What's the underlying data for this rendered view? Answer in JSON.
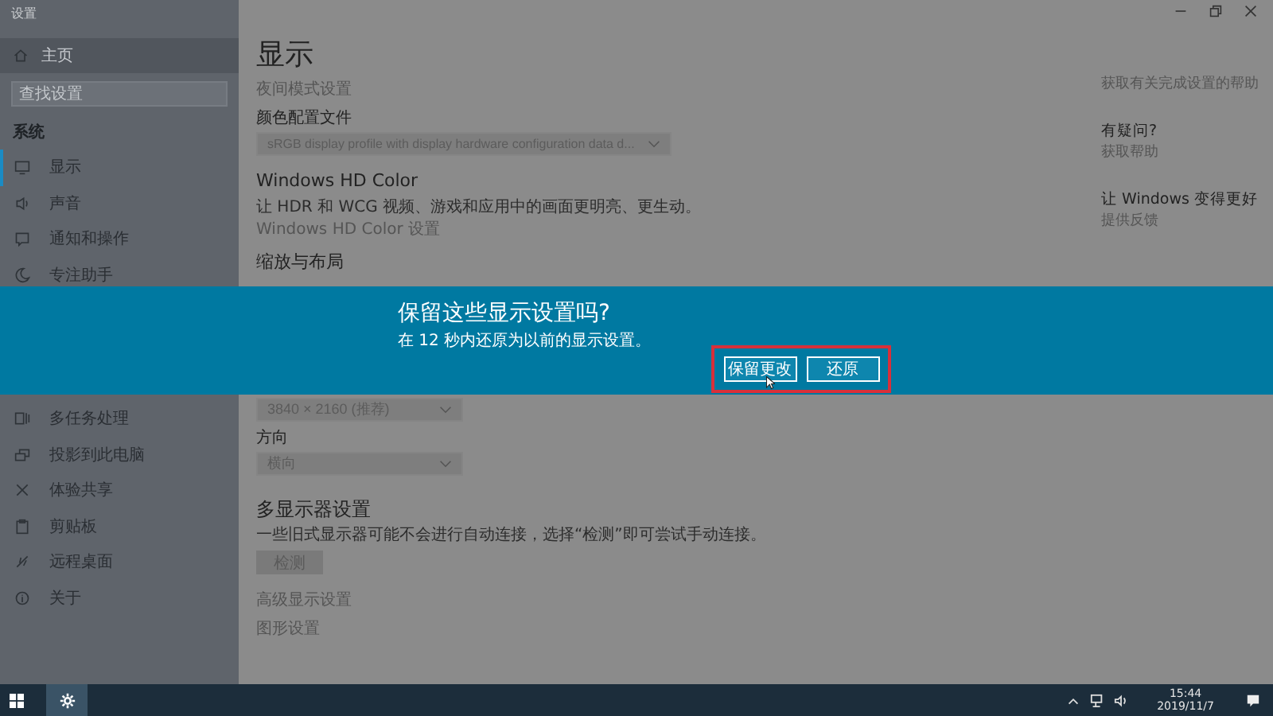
{
  "window": {
    "title": "设置"
  },
  "sidebar": {
    "home": "主页",
    "search": {
      "placeholder": "查找设置"
    },
    "section": "系统",
    "items_top": [
      {
        "label": "显示",
        "selected": true
      },
      {
        "label": "声音",
        "selected": false
      },
      {
        "label": "通知和操作",
        "selected": false
      },
      {
        "label": "专注助手",
        "selected": false
      }
    ],
    "items_bottom": [
      {
        "label": "多任务处理",
        "selected": false
      },
      {
        "label": "投影到此电脑",
        "selected": false
      },
      {
        "label": "体验共享",
        "selected": false
      },
      {
        "label": "剪贴板",
        "selected": false
      },
      {
        "label": "远程桌面",
        "selected": false
      },
      {
        "label": "关于",
        "selected": false
      }
    ]
  },
  "main": {
    "title": "显示",
    "night_link": "夜间模式设置",
    "color_profile": {
      "label": "颜色配置文件",
      "value": "sRGB display profile with display hardware configuration data d..."
    },
    "hd_color": {
      "heading": "Windows HD Color",
      "text": "让 HDR 和 WCG 视频、游戏和应用中的画面更明亮、更生动。",
      "link": "Windows HD Color 设置"
    },
    "scale_heading": "缩放与布局",
    "resolution": {
      "value": "3840 × 2160 (推荐)"
    },
    "orientation": {
      "label": "方向",
      "value": "横向"
    },
    "multi": {
      "heading": "多显示器设置",
      "text": "一些旧式显示器可能不会进行自动连接，选择“检测”即可尝试手动连接。",
      "button": "检测"
    },
    "links": [
      "高级显示设置",
      "图形设置"
    ]
  },
  "help": {
    "top_link": "获取有关完成设置的帮助",
    "question": "有疑问?",
    "question_link": "获取帮助",
    "feedback_heading": "让 Windows 变得更好",
    "feedback_link": "提供反馈"
  },
  "dialog": {
    "title": "保留这些显示设置吗?",
    "text": "在 12 秒内还原为以前的显示设置。",
    "buttons": [
      "保留更改",
      "还原"
    ]
  },
  "taskbar": {
    "time": "15:44",
    "date": "2019/11/7"
  }
}
